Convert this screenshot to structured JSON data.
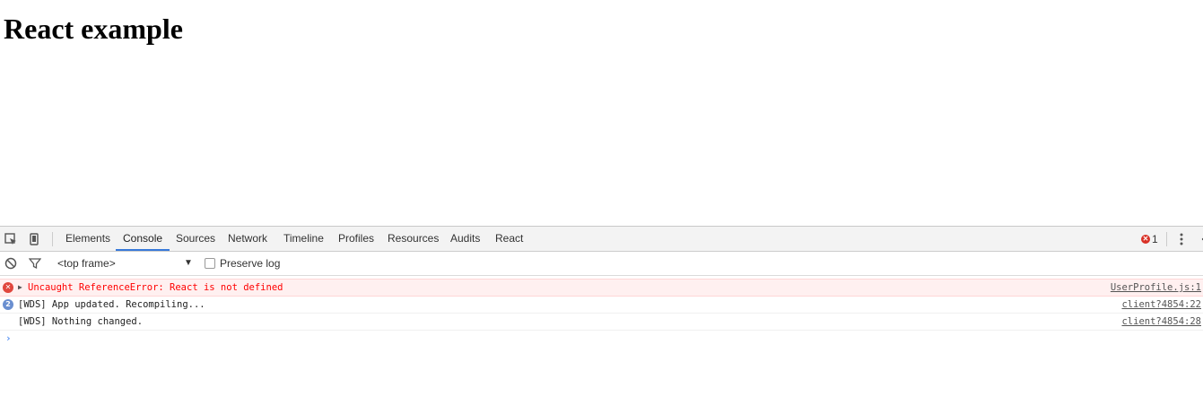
{
  "page": {
    "title": "React example"
  },
  "devtools": {
    "tabs": [
      {
        "label": "Elements",
        "active": false
      },
      {
        "label": "Console",
        "active": true
      },
      {
        "label": "Sources",
        "active": false
      },
      {
        "label": "Network",
        "active": false
      },
      {
        "label": "Timeline",
        "active": false
      },
      {
        "label": "Profiles",
        "active": false
      },
      {
        "label": "Resources",
        "active": false
      },
      {
        "label": "Audits",
        "active": false
      },
      {
        "label": "React",
        "active": false
      }
    ],
    "error_count": "1",
    "accent_color": "#3879d9",
    "error_color": "#ff0000"
  },
  "console_toolbar": {
    "frame_select": "<top frame>",
    "preserve_log_label": "Preserve log"
  },
  "console": {
    "lines": [
      {
        "type": "error",
        "message": "Uncaught ReferenceError: React is not defined",
        "source": "UserProfile.js:1"
      },
      {
        "type": "info",
        "count": "2",
        "message": "[WDS] App updated. Recompiling...",
        "source": "client?4854:22"
      },
      {
        "type": "log",
        "message": "[WDS] Nothing changed.",
        "source": "client?4854:28"
      }
    ],
    "prompt_symbol": "›"
  }
}
